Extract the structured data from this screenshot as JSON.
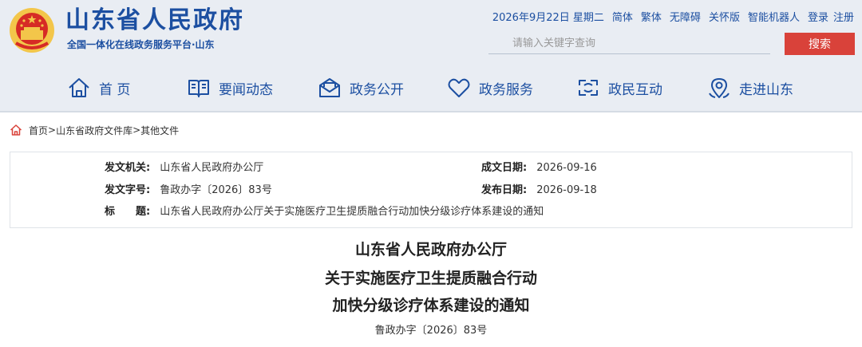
{
  "header": {
    "site_title": "山东省人民政府",
    "site_subtitle": "全国一体化在线政务服务平台·山东",
    "date_text": "2026年9月22日 星期二",
    "utility_links": [
      "简体",
      "繁体",
      "无障碍",
      "关怀版",
      "智能机器人",
      "登录",
      "注册"
    ],
    "search": {
      "placeholder": "请输入关键字查询",
      "button_label": "搜索"
    }
  },
  "nav": {
    "items": [
      {
        "label": "首 页",
        "icon": "home-icon"
      },
      {
        "label": "要闻动态",
        "icon": "book-icon"
      },
      {
        "label": "政务公开",
        "icon": "mail-icon"
      },
      {
        "label": "政务服务",
        "icon": "heart-icon"
      },
      {
        "label": "政民互动",
        "icon": "interaction-icon"
      },
      {
        "label": "走进山东",
        "icon": "location-icon"
      }
    ]
  },
  "breadcrumb": {
    "items": [
      "首页",
      "山东省政府文件库",
      "其他文件"
    ],
    "separator": ">"
  },
  "meta": {
    "issuer_label": "发文机关:",
    "issuer": "山东省人民政府办公厅",
    "doc_no_label": "发文字号:",
    "doc_no": "鲁政办字〔2026〕83号",
    "subject_label": "标　　题:",
    "subject": "山东省人民政府办公厅关于实施医疗卫生提质融合行动加快分级诊疗体系建设的通知",
    "written_label": "成文日期:",
    "written_date": "2026-09-16",
    "publish_label": "发布日期:",
    "publish_date": "2026-09-18"
  },
  "document": {
    "title_lines": [
      "山东省人民政府办公厅",
      "关于实施医疗卫生提质融合行动",
      "加快分级诊疗体系建设的通知"
    ],
    "doc_number": "鲁政办字〔2026〕83号"
  },
  "colors": {
    "brand_blue": "#1c4fa1",
    "search_red": "#d9423a",
    "header_bg": "#e9edf3"
  }
}
